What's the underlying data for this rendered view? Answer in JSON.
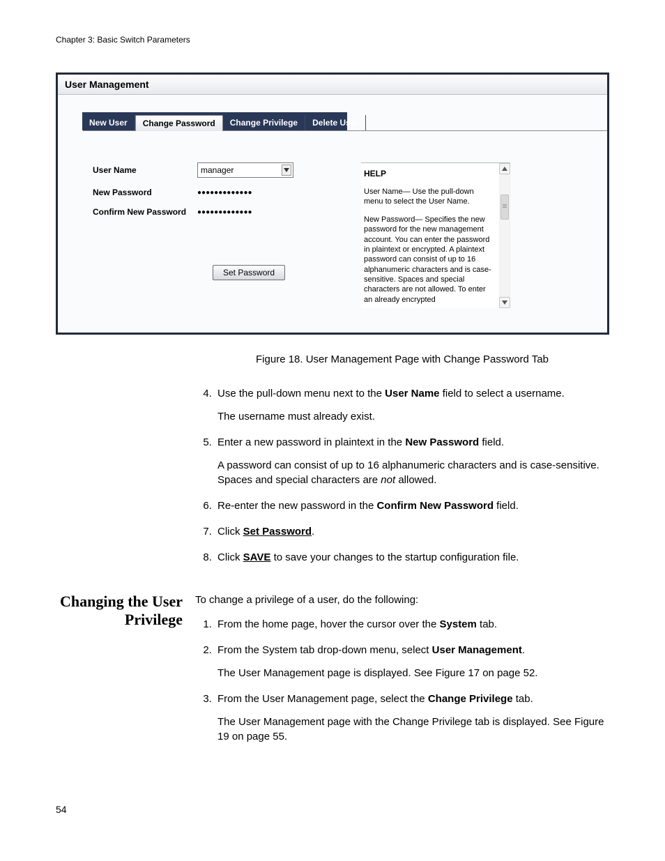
{
  "header": {
    "chapter": "Chapter 3: Basic Switch Parameters"
  },
  "screenshot": {
    "title": "User Management",
    "tabs": {
      "new_user": "New User",
      "change_password": "Change Password",
      "change_privilege": "Change Privilege",
      "delete_user": "Delete User"
    },
    "form": {
      "user_name_label": "User Name",
      "user_name_value": "manager",
      "new_password_label": "New Password",
      "new_password_mask": "●●●●●●●●●●●●●",
      "confirm_label": "Confirm New Password",
      "confirm_mask": "●●●●●●●●●●●●●",
      "button": "Set Password"
    },
    "help": {
      "heading": "HELP",
      "p1": "User Name— Use the pull-down menu to select the User Name.",
      "p2": "New Password— Specifies the new password for the new management account. You can enter the password in plaintext or encrypted. A plaintext password can consist of up to 16 alphanumeric characters and is case-sensitive. Spaces and special characters are not allowed. To enter an already encrypted"
    }
  },
  "figure_caption": "Figure 18. User Management Page with Change Password Tab",
  "steps_a": {
    "s4_a": "Use the pull-down menu next to the ",
    "s4_b": "User Name",
    "s4_c": " field to select a username.",
    "s4_p": "The username must already exist.",
    "s5_a": "Enter a new password in plaintext in the ",
    "s5_b": "New Password",
    "s5_c": " field.",
    "s5_p_a": "A password can consist of up to 16 alphanumeric characters and is case-sensitive. Spaces and special characters are ",
    "s5_p_b": "not",
    "s5_p_c": " allowed.",
    "s6_a": "Re-enter the new password in the ",
    "s6_b": "Confirm New Password",
    "s6_c": " field.",
    "s7_a": "Click ",
    "s7_b": "Set Password",
    "s7_c": ".",
    "s8_a": "Click ",
    "s8_b": "SAVE",
    "s8_c": " to save your changes to the startup configuration file."
  },
  "side_heading": "Changing the User Privilege",
  "section_b_intro": "To change a privilege of a user, do the following:",
  "steps_b": {
    "s1_a": "From the home page, hover the cursor over the ",
    "s1_b": "System",
    "s1_c": " tab.",
    "s2_a": "From the System tab drop-down menu, select ",
    "s2_b": "User Management",
    "s2_c": ".",
    "s2_p": "The User Management page is displayed. See Figure 17 on page 52.",
    "s3_a": "From the User Management page, select the ",
    "s3_b": "Change Privilege",
    "s3_c": " tab.",
    "s3_p": "The User Management page with the Change Privilege tab is displayed. See Figure 19 on page 55."
  },
  "page_number": "54"
}
